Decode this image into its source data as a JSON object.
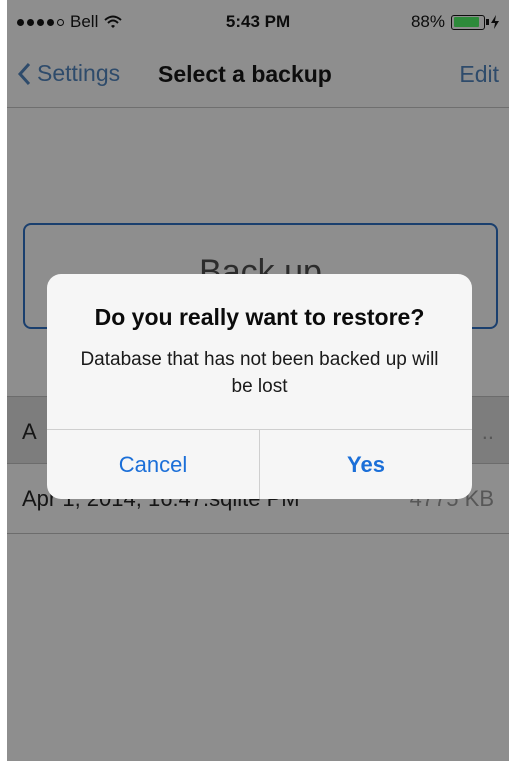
{
  "status_bar": {
    "carrier": "Bell",
    "time": "5:43 PM",
    "battery_percent": "88%",
    "battery_level": 0.88,
    "signal_bars_filled": 4,
    "signal_bars_total": 5
  },
  "nav": {
    "back_label": "Settings",
    "title": "Select a backup",
    "edit_label": "Edit"
  },
  "backup_button_label": "Back up",
  "backups": [
    {
      "name": "A",
      "size": ".."
    },
    {
      "name": "Apr 1, 2014, 16:47.sqlite PM",
      "size": "4775 KB"
    }
  ],
  "alert": {
    "title": "Do you really want to restore?",
    "message": "Database that has not been backed up will be lost",
    "cancel_label": "Cancel",
    "confirm_label": "Yes"
  },
  "colors": {
    "tint": "#1b6fd8",
    "battery": "#2d8a3a",
    "dim_overlay": "#8e8e8e"
  }
}
